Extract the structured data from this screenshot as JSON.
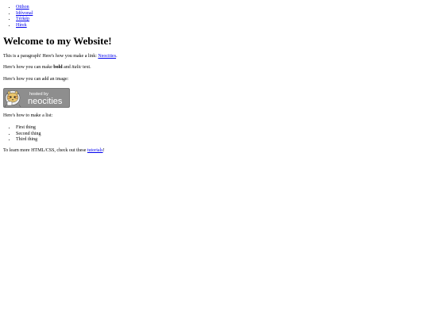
{
  "nav": {
    "items": [
      {
        "label": "Otthon"
      },
      {
        "label": "Idővonal"
      },
      {
        "label": "Térkép"
      },
      {
        "label": "Hírek"
      }
    ]
  },
  "main": {
    "heading": "Welcome to my Website!",
    "para1_text": "This is a paragraph! Here's how you make a link: ",
    "para1_link": "Neocities",
    "para1_end": ".",
    "para2_start": "Here's how you can make ",
    "para2_bold": "bold",
    "para2_mid": " and ",
    "para2_italic": "italic",
    "para2_end": " text.",
    "para3": "Here's how you can add an image:",
    "image": {
      "text_small": "hosted by",
      "text_large": "neocities",
      "bg_color": "#8e8e8e",
      "cat_color": "#e9c46a"
    },
    "para4": "Here's how to make a list:",
    "list": [
      {
        "label": "First thing"
      },
      {
        "label": "Second thing"
      },
      {
        "label": "Third thing"
      }
    ],
    "para5_start": "To learn more HTML/CSS, check out these ",
    "para5_link": "tutorials",
    "para5_end": "!"
  }
}
